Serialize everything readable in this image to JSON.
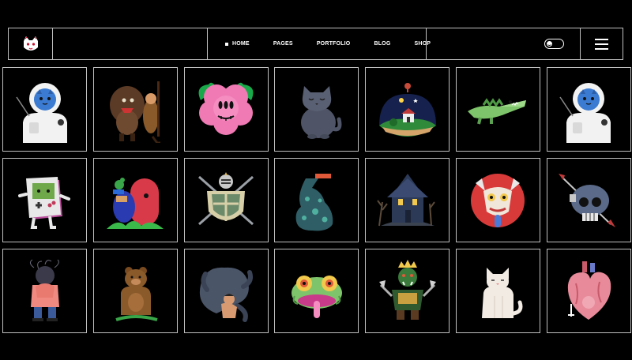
{
  "nav": {
    "items": [
      {
        "label": "HOME",
        "active": true
      },
      {
        "label": "PAGES",
        "active": false
      },
      {
        "label": "PORTFOLIO",
        "active": false
      },
      {
        "label": "BLOG",
        "active": false
      },
      {
        "label": "SHOP",
        "active": false
      }
    ]
  },
  "icons": {
    "logo": "cat-mask-logo-icon",
    "theme_toggle": "theme-toggle",
    "menu": "hamburger-menu-icon"
  },
  "colors": {
    "background": "#000000",
    "border": "#bfbfbf",
    "text": "#ffffff"
  },
  "gallery": [
    "astronaut-cat-illustration",
    "caveman-warrior-illustration",
    "pink-flower-creature-illustration",
    "gray-cat-illustration",
    "night-island-house-illustration",
    "green-crocodile-illustration",
    "astronaut-cat-illustration",
    "game-console-character-illustration",
    "red-giant-with-bird-illustration",
    "knight-shield-illustration",
    "spotted-creature-illustration",
    "haunted-house-illustration",
    "demon-mask-illustration",
    "skull-with-arrow-illustration",
    "sad-girl-illustration",
    "bear-illustration",
    "tentacle-girl-illustration",
    "frog-tongue-illustration",
    "orc-warrior-illustration",
    "white-cat-illustration",
    "anatomical-heart-illustration"
  ]
}
